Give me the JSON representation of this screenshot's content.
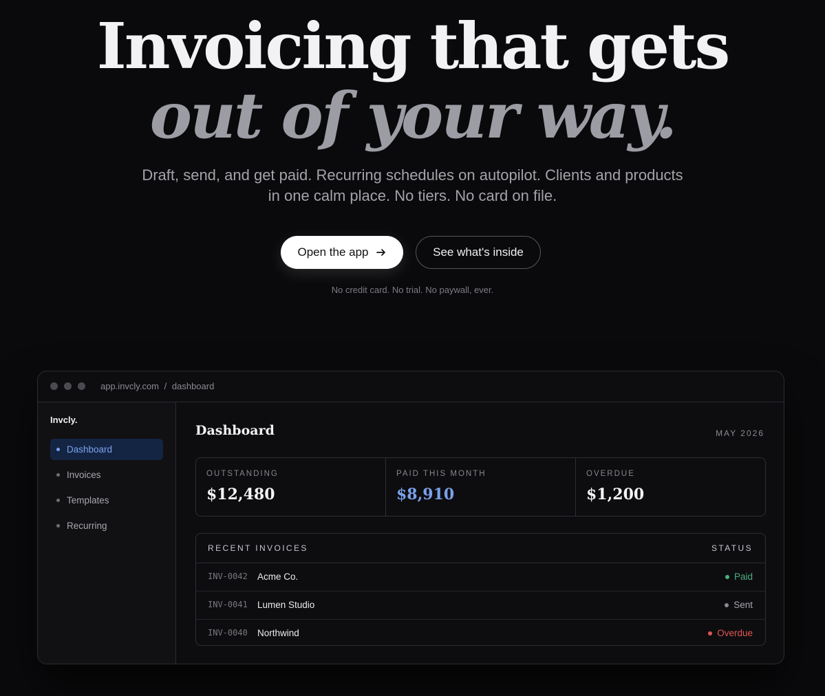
{
  "hero": {
    "title_line1": "Invoicing that gets",
    "title_line2": "out of your way.",
    "subtitle": "Draft, send, and get paid. Recurring schedules on autopilot. Clients and products in one calm place. No tiers. No card on file.",
    "primary_cta": "Open the app",
    "primary_cta_icon": "arrow-right-icon",
    "secondary_cta": "See what's inside",
    "note": "No credit card. No trial. No paywall, ever."
  },
  "window": {
    "url_host": "app.invcly.com",
    "url_sep": "/",
    "url_path": "dashboard"
  },
  "sidebar": {
    "brand": "Invcly.",
    "items": [
      {
        "label": "Dashboard",
        "active": true
      },
      {
        "label": "Invoices",
        "active": false
      },
      {
        "label": "Templates",
        "active": false
      },
      {
        "label": "Recurring",
        "active": false
      }
    ]
  },
  "dashboard": {
    "title": "Dashboard",
    "period": "MAY 2026",
    "stats": [
      {
        "label": "OUTSTANDING",
        "value": "$12,480"
      },
      {
        "label": "PAID THIS MONTH",
        "value": "$8,910"
      },
      {
        "label": "OVERDUE",
        "value": "$1,200"
      }
    ],
    "recent": {
      "heading": "RECENT INVOICES",
      "status_heading": "STATUS",
      "rows": [
        {
          "id": "INV-0042",
          "client": "Acme Co.",
          "status": "Paid"
        },
        {
          "id": "INV-0041",
          "client": "Lumen Studio",
          "status": "Sent"
        },
        {
          "id": "INV-0040",
          "client": "Northwind",
          "status": "Overdue"
        }
      ]
    }
  },
  "colors": {
    "background": "#0a0a0c",
    "accent": "#7aa2ec",
    "paid": "#4caf7d",
    "sent": "#8a8a92",
    "overdue": "#e2554f"
  }
}
